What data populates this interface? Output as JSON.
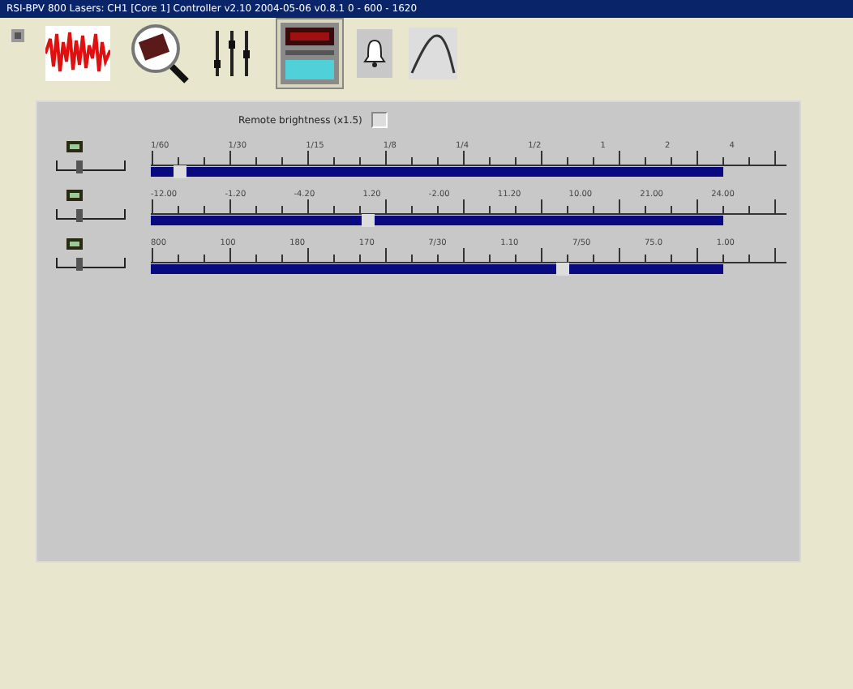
{
  "window": {
    "title": "RSI-BPV 800 Lasers: CH1 [Core 1] Controller v2.10 2004-05-06 v0.8.1 0 - 600 - 1620"
  },
  "toolbar": [
    {
      "kind": "wave",
      "selected": false
    },
    {
      "kind": "magnifier",
      "selected": false
    },
    {
      "kind": "sliders",
      "selected": false
    },
    {
      "kind": "display",
      "selected": true
    },
    {
      "kind": "bell",
      "selected": false
    },
    {
      "kind": "curve",
      "selected": false
    }
  ],
  "option": {
    "label": "Remote brightness (x1.5)",
    "checked": false
  },
  "sliders": [
    {
      "ticks": [
        "1/60",
        "1/30",
        "1/15",
        "1/8",
        "1/4",
        "1/2",
        "1",
        "2",
        "4"
      ],
      "level": 0.05
    },
    {
      "ticks": [
        "-12.00",
        "-1.20",
        "-4.20",
        "1.20",
        "-2.00",
        "11.20",
        "10.00",
        "21.00",
        "24.00"
      ],
      "level": 0.38
    },
    {
      "ticks": [
        "800",
        "100",
        "180",
        "170",
        "7/30",
        "1.10",
        "7/50",
        "75.0",
        "1.00"
      ],
      "level": 0.72
    }
  ]
}
